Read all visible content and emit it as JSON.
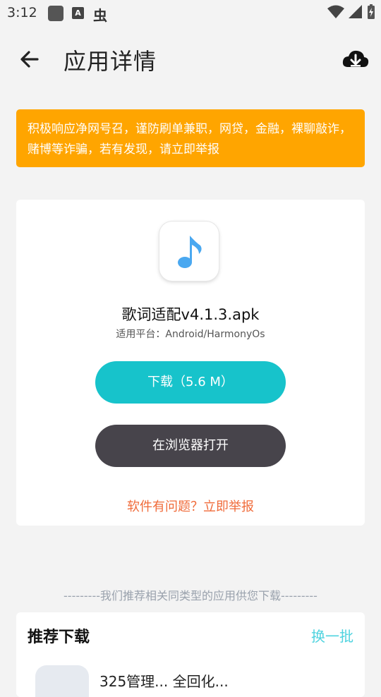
{
  "status_bar": {
    "time": "3:12",
    "a_icon_label": "A",
    "bug_glyph": "虫"
  },
  "header": {
    "title": "应用详情"
  },
  "warning": {
    "text": "积极响应净网号召，谨防刷单兼职，网贷，金融，裸聊敲诈，赌博等诈骗，若有发现，请立即举报"
  },
  "app": {
    "name": "歌词适配v4.1.3.apk",
    "platform": "适用平台：Android/HarmonyOs",
    "download_label": "下载（5.6 M）",
    "browser_label": "在浏览器打开",
    "report_label": "软件有问题？立即举报"
  },
  "recommend": {
    "divider": "---------我们推荐相关同类型的应用供您下载---------",
    "title": "推荐下载",
    "refresh_label": "换一批",
    "first_item_name": "325管理... 全回化..."
  },
  "colors": {
    "warning_bg": "#ffa500",
    "download_btn": "#17c3cb",
    "browser_btn": "#47444b",
    "report_link": "#f06b3a",
    "refresh_link": "#4fd3df",
    "music_note": "#4aa8f0"
  }
}
